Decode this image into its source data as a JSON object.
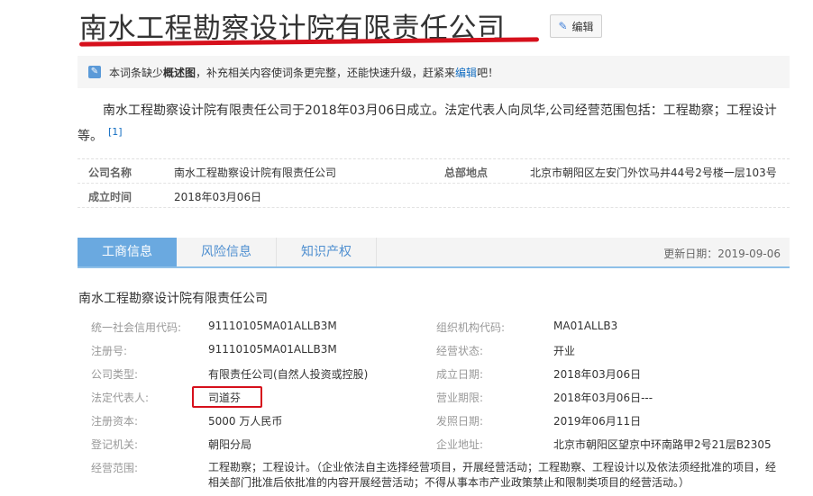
{
  "title": "南水工程勘察设计院有限责任公司",
  "edit_button": "编辑",
  "notice": {
    "prefix": "本词条缺少",
    "bold": "概述图",
    "middle": "，补充相关内容使词条更完整，还能快速升级，赶紧来",
    "link": "编辑",
    "suffix": "吧！"
  },
  "summary": {
    "text": "南水工程勘察设计院有限责任公司于2018年03月06日成立。法定代表人向凤华,公司经营范围包括：工程勘察；工程设计等。",
    "ref": "[1]"
  },
  "basic_info": {
    "company_name_label": "公司名称",
    "company_name": "南水工程勘察设计院有限责任公司",
    "hq_label": "总部地点",
    "hq": "北京市朝阳区左安门外饮马井44号2号楼一层103号",
    "founded_label": "成立时间",
    "founded": "2018年03月06日"
  },
  "tabs": [
    {
      "label": "工商信息",
      "active": true
    },
    {
      "label": "风险信息",
      "active": false
    },
    {
      "label": "知识产权",
      "active": false
    }
  ],
  "update_date": "更新日期：2019-09-06",
  "company_heading": "南水工程勘察设计院有限责任公司",
  "business": {
    "credit_code_label": "统一社会信用代码:",
    "credit_code": "91110105MA01ALLB3M",
    "org_code_label": "组织机构代码:",
    "org_code": "MA01ALLB3",
    "reg_no_label": "注册号:",
    "reg_no": "91110105MA01ALLB3M",
    "status_label": "经营状态:",
    "status": "开业",
    "type_label": "公司类型:",
    "type": "有限责任公司(自然人投资或控股)",
    "est_date_label": "成立日期:",
    "est_date": "2018年03月06日",
    "rep_label": "法定代表人:",
    "rep": "司道芬",
    "term_label": "营业期限:",
    "term": "2018年03月06日---",
    "capital_label": "注册资本:",
    "capital": "5000 万人民币",
    "issue_label": "发照日期:",
    "issue": "2019年06月11日",
    "authority_label": "登记机关:",
    "authority": "朝阳分局",
    "address_label": "企业地址:",
    "address": "北京市朝阳区望京中环南路甲2号21层B2305",
    "scope_label": "经营范围:",
    "scope": "工程勘察；工程设计。（企业依法自主选择经营项目，开展经营活动；工程勘察、工程设计以及依法须经批准的项目，经相关部门批准后依批准的内容开展经营活动；不得从事本市产业政策禁止和限制类项目的经营活动。）"
  }
}
